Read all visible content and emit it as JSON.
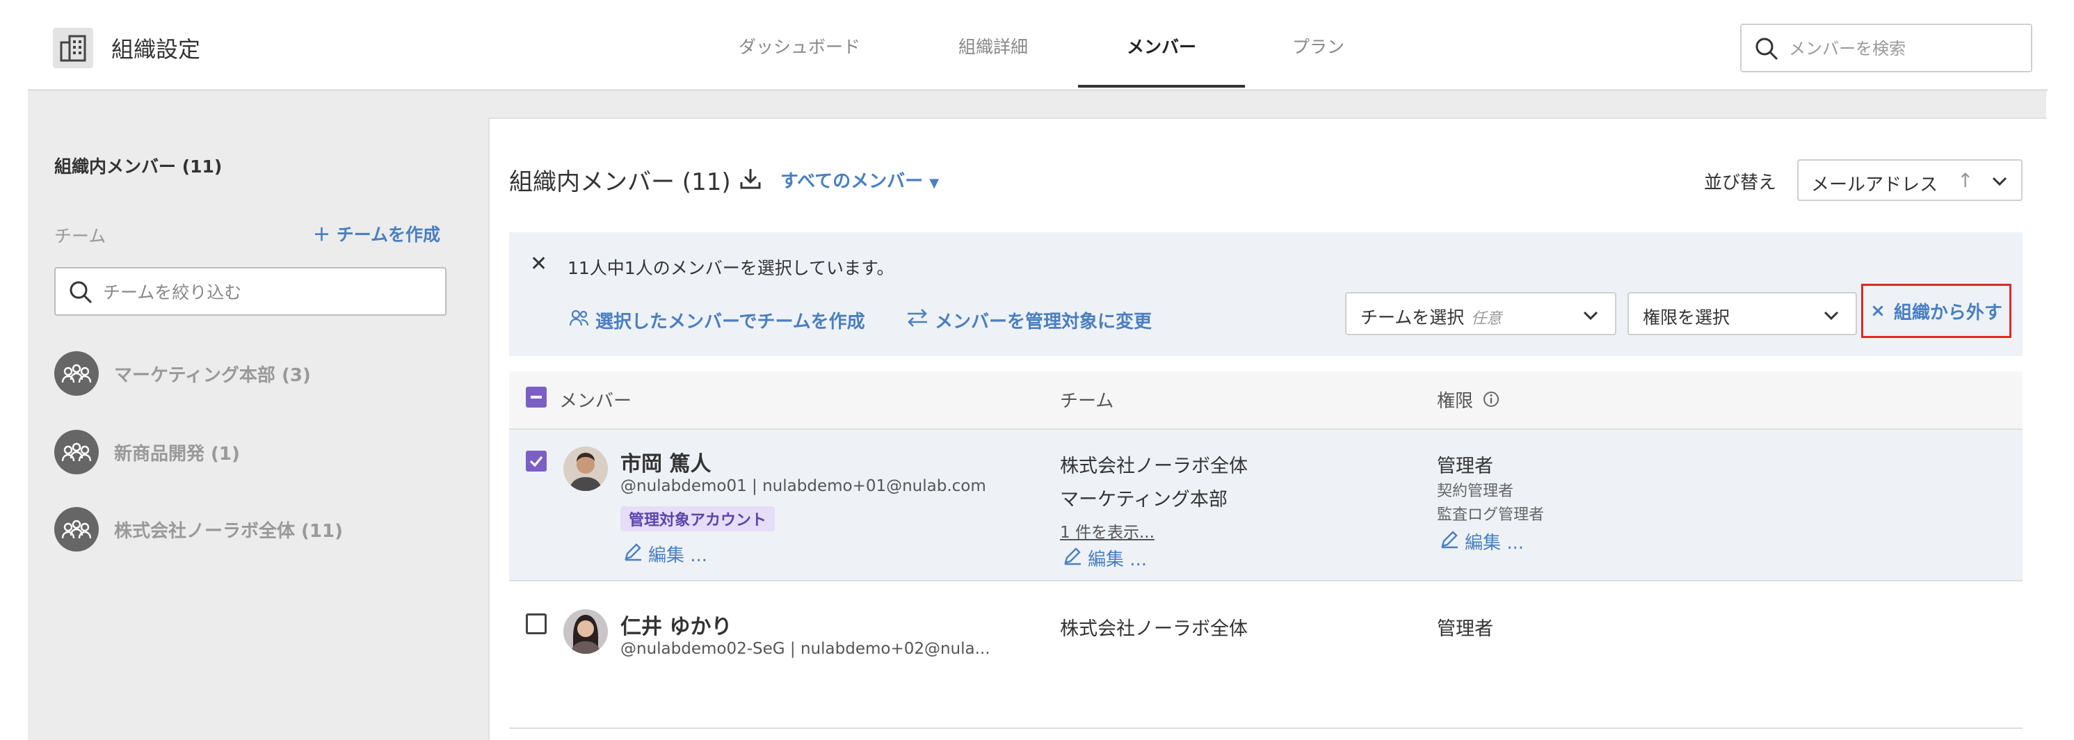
{
  "header": {
    "title": "組織設定",
    "tabs": [
      {
        "label": "ダッシュボード"
      },
      {
        "label": "組織詳細"
      },
      {
        "label": "メンバー"
      },
      {
        "label": "プラン"
      }
    ],
    "search_placeholder": "メンバーを検索"
  },
  "sidebar": {
    "title": "組織内メンバー (11)",
    "team_label": "チーム",
    "create_team": "チームを作成",
    "filter_placeholder": "チームを絞り込む",
    "teams": [
      {
        "name": "マーケティング本部 (3)"
      },
      {
        "name": "新商品開発 (1)"
      },
      {
        "name": "株式会社ノーラボ全体 (11)"
      }
    ]
  },
  "main": {
    "title": "組織内メンバー (11)",
    "filter_dropdown": "すべてのメンバー",
    "sort_label": "並び替え",
    "sort_value": "メールアドレス",
    "banner": {
      "text": "11人中1人のメンバーを選択しています。",
      "action_create_team": "選択したメンバーでチームを作成",
      "action_change_managed": "メンバーを管理対象に変更",
      "team_select_label": "チームを選択",
      "team_select_hint": "任意",
      "role_select_label": "権限を選択",
      "remove_label": "組織から外す"
    },
    "columns": {
      "member": "メンバー",
      "team": "チーム",
      "role": "権限"
    },
    "rows": [
      {
        "name": "市岡 篤人",
        "sub": "@nulabdemo01 | nulabdemo+01@nulab.com",
        "badge": "管理対象アカウント",
        "edit": "編集 ...",
        "teams": [
          "株式会社ノーラボ全体",
          "マーケティング本部"
        ],
        "more": "1 件を表示...",
        "team_edit": "編集 ...",
        "role": "管理者",
        "role_subs": [
          "契約管理者",
          "監査ログ管理者"
        ],
        "role_edit": "編集 ..."
      },
      {
        "name": "仁井 ゆかり",
        "sub": "@nulabdemo02-SeG | nulabdemo+02@nula...",
        "teams": [
          "株式会社ノーラボ全体"
        ],
        "role": "管理者"
      }
    ]
  },
  "colors": {
    "accent": "#4a7fc1",
    "checkbox": "#7b5fc7",
    "highlight_border": "#e02828"
  }
}
